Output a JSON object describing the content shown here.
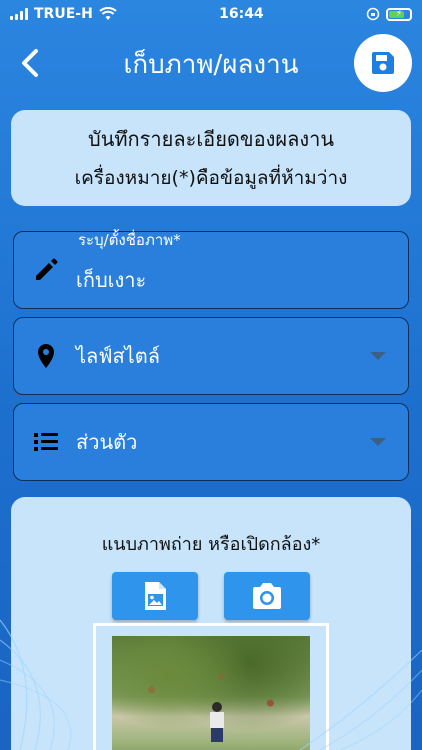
{
  "status": {
    "carrier": "TRUE-H",
    "time": "16:44"
  },
  "header": {
    "title": "เก็บภาพ/ผลงาน"
  },
  "info": {
    "title": "บันทึกรายละเอียดของผลงาน",
    "subtitle": "เครื่องหมาย(*)คือข้อมูลที่ห้ามว่าง"
  },
  "fields": {
    "name_label": "ระบุ/ตั้งชื่อภาพ*",
    "name_value": "เก็บเงาะ",
    "category_value": "ไลฟ์สไตล์",
    "privacy_value": "ส่วนตัว"
  },
  "attach": {
    "label": "แนบภาพถ่าย หรือเปิดกล้อง*"
  },
  "icons": {
    "back": "chevron-left-icon",
    "save": "floppy-disk-icon",
    "pencil": "pencil-icon",
    "location": "map-pin-icon",
    "list": "list-icon",
    "gallery": "image-file-icon",
    "camera": "camera-icon"
  },
  "colors": {
    "background": "#2b86e0",
    "card": "#c7e4fb",
    "button": "#2e94ec",
    "save_icon": "#1f7fe0"
  }
}
